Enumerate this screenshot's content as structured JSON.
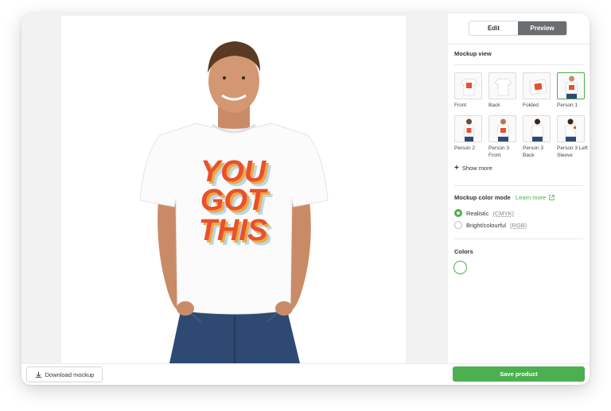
{
  "view_toggle": {
    "edit_label": "Edit",
    "preview_label": "Preview",
    "active": "Preview"
  },
  "mockup_view": {
    "title": "Mockup view",
    "items": [
      {
        "label": "Front",
        "selected": false
      },
      {
        "label": "Back",
        "selected": false
      },
      {
        "label": "Folded",
        "selected": false
      },
      {
        "label": "Person 1",
        "selected": true
      },
      {
        "label": "Person 2",
        "selected": false
      },
      {
        "label": "Person 3 Front",
        "selected": false
      },
      {
        "label": "Person 3 Back",
        "selected": false
      },
      {
        "label": "Person 3 Left Sleeve",
        "selected": false
      }
    ],
    "show_more_label": "Show more"
  },
  "color_mode": {
    "title": "Mockup color mode",
    "learn_more_label": "Learn more",
    "options": [
      {
        "label": "Realistic",
        "suffix": "(CMYK)",
        "selected": true
      },
      {
        "label": "Bright/colourful",
        "suffix": "(RGB)",
        "selected": false
      }
    ]
  },
  "colors": {
    "title": "Colors",
    "swatches": [
      "#ffffff"
    ]
  },
  "footer": {
    "download_label": "Download mockup",
    "save_label": "Save product"
  },
  "preview": {
    "shirt_text_lines": [
      "YOU",
      "GOT",
      "THIS"
    ],
    "shirt_color": "#ffffff",
    "print_colors": [
      "#e8502f",
      "#f2a93b",
      "#b9d7ee"
    ]
  },
  "theme": {
    "accent": "#4caf50",
    "toggle_active_bg": "#6b6e70"
  }
}
